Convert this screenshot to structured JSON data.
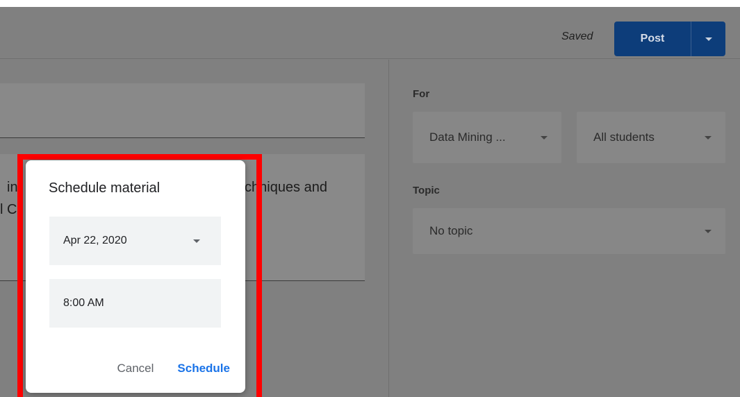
{
  "header": {
    "saved_label": "Saved",
    "post_label": "Post",
    "post_menu_icon": "caret-down-icon"
  },
  "editor": {
    "desc_line1_left": "in",
    "desc_line1_right": "chniques and",
    "desc_line2_left": "l C"
  },
  "sidebar": {
    "for_label": "For",
    "class_value": "Data Mining ...",
    "students_value": "All students",
    "topic_label": "Topic",
    "topic_value": "No topic"
  },
  "dialog": {
    "title": "Schedule material",
    "date_value": "Apr 22, 2020",
    "time_value": "8:00 AM",
    "cancel_label": "Cancel",
    "schedule_label": "Schedule"
  },
  "colors": {
    "highlight": "#ff0000",
    "accent": "#1a73e8",
    "post_button": "#0d3d7a"
  }
}
